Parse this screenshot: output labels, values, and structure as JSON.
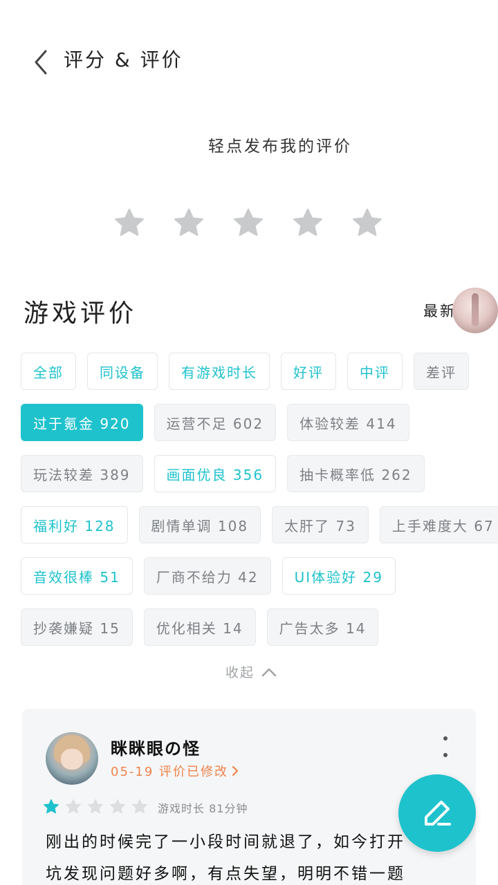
{
  "header": {
    "title": "评分 & 评价"
  },
  "rating": {
    "prompt": "轻点发布我的评价",
    "star_count": 5
  },
  "section": {
    "title": "游戏评价",
    "sort_label": "最新"
  },
  "tags": [
    [
      {
        "label": "全部",
        "style": "teal"
      },
      {
        "label": "同设备",
        "style": "teal"
      },
      {
        "label": "有游戏时长",
        "style": "teal"
      },
      {
        "label": "好评",
        "style": "teal"
      },
      {
        "label": "中评",
        "style": "teal"
      },
      {
        "label": "差评",
        "style": "gray"
      }
    ],
    [
      {
        "label": "过于氪金 920",
        "style": "active"
      },
      {
        "label": "运营不足 602",
        "style": "gray"
      },
      {
        "label": "体验较差 414",
        "style": "gray"
      }
    ],
    [
      {
        "label": "玩法较差 389",
        "style": "gray"
      },
      {
        "label": "画面优良 356",
        "style": "teal"
      },
      {
        "label": "抽卡概率低 262",
        "style": "gray"
      }
    ],
    [
      {
        "label": "福利好 128",
        "style": "teal"
      },
      {
        "label": "剧情单调 108",
        "style": "gray"
      },
      {
        "label": "太肝了 73",
        "style": "gray"
      },
      {
        "label": "上手难度大 67",
        "style": "gray"
      }
    ],
    [
      {
        "label": "音效很棒 51",
        "style": "teal"
      },
      {
        "label": "厂商不给力 42",
        "style": "gray"
      },
      {
        "label": "UI体验好 29",
        "style": "teal"
      }
    ],
    [
      {
        "label": "抄袭嫌疑 15",
        "style": "gray"
      },
      {
        "label": "优化相关 14",
        "style": "gray"
      },
      {
        "label": "广告太多 14",
        "style": "gray"
      }
    ]
  ],
  "collapse_label": "收起",
  "review": {
    "username": "眯眯眼の怪",
    "date_status": "05-19 评价已修改",
    "stars_filled": 1,
    "stars_total": 5,
    "playtime": "游戏时长 81分钟",
    "text_line1": "刚出的时候完了一小段时间就退了，如今打开",
    "text_line2": "坑发现问题好多啊，有点失望，明明不错一题"
  },
  "colors": {
    "accent": "#1ec2cc",
    "date": "#f0834a",
    "star_empty": "#c8cacc"
  }
}
